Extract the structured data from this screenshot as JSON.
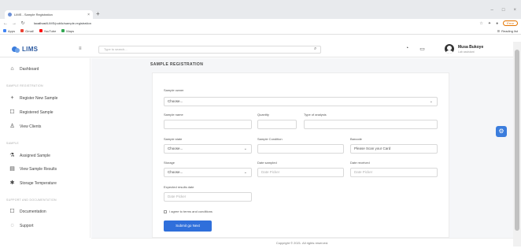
{
  "browser": {
    "tab_title": "LIMS - Sample Registration",
    "new_tab": "+",
    "tab_close": "×",
    "back": "←",
    "forward": "→",
    "reload": "↻",
    "url_host": "localhost",
    "url_path": "/LIMS/public/sample-registration",
    "update_label": "Error",
    "bookmarks": [
      {
        "label": "Apps",
        "color": "#4285f4"
      },
      {
        "label": "Gmail",
        "color": "#ea4335"
      },
      {
        "label": "YouTube",
        "color": "#ff0000"
      },
      {
        "label": "Maps",
        "color": "#34a853"
      }
    ],
    "reading_list": "Reading list",
    "win_min": "–",
    "win_max": "□",
    "win_close": "×"
  },
  "header": {
    "logo_text": "LIMS",
    "collapse_icon": "≡",
    "search_placeholder": "Type to search...",
    "search_icon": "⌕",
    "bell_icon": "♫",
    "chat_icon": "▭",
    "user_name": "Musa Bukoye",
    "user_role": "Lab assistant"
  },
  "sidebar": {
    "dashboard": {
      "label": "Dashboard",
      "icon": "⌂"
    },
    "section_registration": "Sample Registration",
    "register_new": {
      "label": "Register New Sample",
      "icon": "+"
    },
    "registered": {
      "label": "Registered Sample",
      "icon": "☐"
    },
    "view_clients": {
      "label": "View Clients",
      "icon": "♙"
    },
    "section_sample": "Sample",
    "assigned": {
      "label": "Assigned Sample",
      "icon": "⚗"
    },
    "view_results": {
      "label": "View Sample Results",
      "icon": "▤"
    },
    "storage_temp": {
      "label": "Storage Temperature",
      "icon": "✱"
    },
    "section_support": "Support and Documentation",
    "documentation": {
      "label": "Documentation",
      "icon": "☐"
    },
    "support": {
      "label": "Support",
      "icon": "◌"
    }
  },
  "page": {
    "title": "SAMPLE REGISTRATION"
  },
  "form": {
    "sample_owner_label": "Sample owner",
    "sample_owner_value": "Choose...",
    "sample_name_label": "Sample name",
    "quantity_label": "Quantity",
    "type_of_analysis_label": "Type of analysis",
    "sample_state_label": "Sample state",
    "sample_state_value": "Choose...",
    "sample_condition_label": "Sample Condition",
    "barcode_label": "Barcode",
    "barcode_placeholder": "Please Scan your Card",
    "storage_label": "Storage",
    "storage_value": "Choose...",
    "date_sampled_label": "Date sampled",
    "date_sampled_placeholder": "Date Picker",
    "date_received_label": "Date received",
    "date_received_placeholder": "Date Picker",
    "expected_results_label": "Expected results date",
    "expected_results_placeholder": "Date Picker",
    "terms_label": "I agree to terms and conditions",
    "submit_label": "Submit go Next"
  },
  "footer": {
    "copyright": "Copyright © 2021. All rights reserved."
  },
  "floating": {
    "settings_icon": "⚙"
  }
}
